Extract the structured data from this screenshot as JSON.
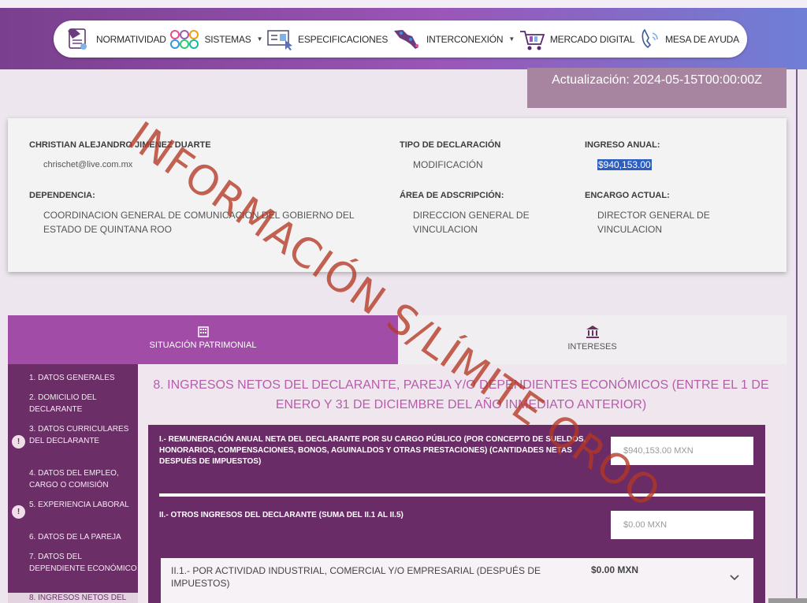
{
  "nav": {
    "items": [
      {
        "label": "NORMATIVIDAD",
        "icon": "law-document-icon",
        "dropdown": false
      },
      {
        "label": "SISTEMAS",
        "icon": "systems-circles-icon",
        "dropdown": true
      },
      {
        "label": "ESPECIFICACIONES",
        "icon": "specifications-icon",
        "dropdown": false
      },
      {
        "label": "INTERCONEXIÓN",
        "icon": "interconnection-map-icon",
        "dropdown": true
      },
      {
        "label": "MERCADO DIGITAL",
        "icon": "shopping-cart-icon",
        "dropdown": false
      },
      {
        "label": "MESA DE AYUDA",
        "icon": "help-phone-icon",
        "dropdown": false
      }
    ]
  },
  "update": {
    "text": "Actualización: 2024-05-15T00:00:00Z"
  },
  "declarant": {
    "name": "CHRISTIAN ALEJANDRO JIMENEZ DUARTE",
    "email": "chrischet@live.com.mx",
    "tipo_label": "TIPO DE DECLARACIÓN",
    "tipo_value": "MODIFICACIÓN",
    "ingreso_label": "INGRESO ANUAL:",
    "ingreso_value": "$940,153.00",
    "dependencia_label": "DEPENDENCIA:",
    "dependencia_value": "COORDINACION GENERAL DE COMUNICACIÓN DEL GOBIERNO DEL ESTADO DE QUINTANA ROO",
    "area_label": "ÁREA DE ADSCRIPCIÓN:",
    "area_value": "DIRECCION GENERAL DE VINCULACION",
    "encargo_label": "ENCARGO ACTUAL:",
    "encargo_value": "DIRECTOR GENERAL DE VINCULACION"
  },
  "tabs": {
    "patrimonial": "SITUACIÓN PATRIMONIAL",
    "intereses": "INTERESES"
  },
  "side": {
    "items": [
      {
        "label": "1. DATOS GENERALES",
        "badge": ""
      },
      {
        "label": "2. DOMICILIO DEL DECLARANTE",
        "badge": ""
      },
      {
        "label": "3. DATOS CURRICULARES DEL DECLARANTE",
        "badge": "!"
      },
      {
        "label": "4. DATOS DEL EMPLEO, CARGO O COMISIÓN",
        "badge": ""
      },
      {
        "label": "5. EXPERIENCIA LABORAL",
        "badge": "!"
      },
      {
        "label": "6. DATOS DE LA PAREJA",
        "badge": ""
      },
      {
        "label": "7. DATOS DEL DEPENDIENTE ECONÓMICO",
        "badge": ""
      }
    ],
    "active": "8. INGRESOS NETOS DEL"
  },
  "main": {
    "title": "8. INGRESOS NETOS DEL DECLARANTE, PAREJA Y/O DEPENDIENTES ECONÓMICOS (ENTRE EL 1 DE ENERO Y 31 DE DICIEMBRE DEL AÑO INMEDIATO ANTERIOR)",
    "section1_label": "I.- REMUNERACIÓN ANUAL NETA DEL DECLARANTE POR SU CARGO PÚBLICO (POR CONCEPTO DE SUELDOS, HONORARIOS, COMPENSACIONES, BONOS, AGUINALDOS Y OTRAS PRESTACIONES) (CANTIDADES NETAS DESPUÉS DE IMPUESTOS)",
    "section1_value": "$940,153.00 MXN",
    "section2_label": "II.- OTROS INGRESOS DEL DECLARANTE (SUMA DEL II.1 AL II.5)",
    "section2_value": "$0.00 MXN",
    "sub1_label": "II.1.- POR ACTIVIDAD INDUSTRIAL, COMERCIAL Y/O EMPRESARIAL (DESPUÉS DE IMPUESTOS)",
    "sub1_value": "$0.00 MXN"
  },
  "watermark": "INFORMACIÓN S/LÍMITE QROO",
  "colors": {
    "accent": "#a14da8",
    "dark_purple": "#6a2c66",
    "watermark": "#b43723"
  }
}
